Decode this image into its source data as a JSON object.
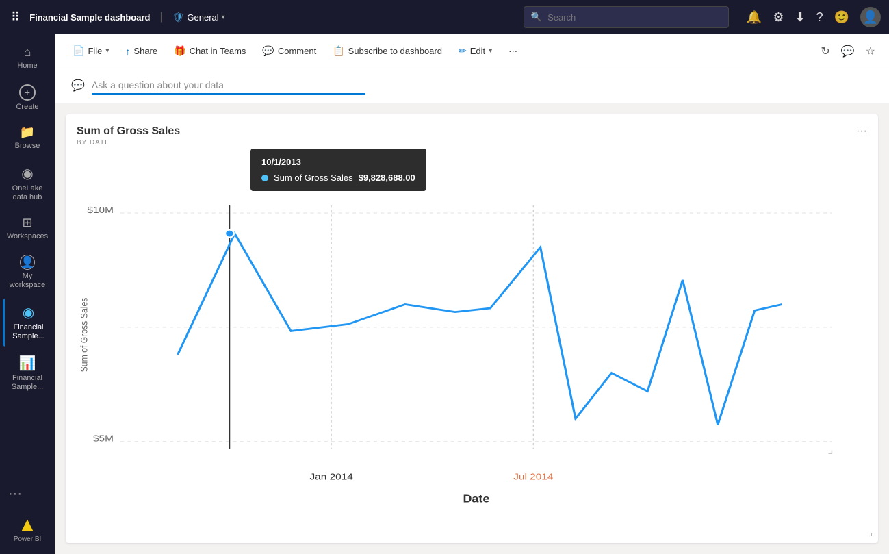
{
  "topnav": {
    "app_title": "Financial Sample dashboard",
    "workspace_name": "General",
    "search_placeholder": "Search"
  },
  "sidebar": {
    "items": [
      {
        "id": "home",
        "label": "Home",
        "icon": "⌂"
      },
      {
        "id": "create",
        "label": "Create",
        "icon": "+"
      },
      {
        "id": "browse",
        "label": "Browse",
        "icon": "📁"
      },
      {
        "id": "onelake",
        "label": "OneLake data hub",
        "icon": "◉"
      },
      {
        "id": "workspaces",
        "label": "Workspaces",
        "icon": "⊞"
      },
      {
        "id": "myworkspace",
        "label": "My workspace",
        "icon": "👤"
      },
      {
        "id": "financial_sample_active",
        "label": "Financial Sample...",
        "icon": "◉",
        "active": true
      },
      {
        "id": "financial_sample_report",
        "label": "Financial Sample...",
        "icon": "📊"
      }
    ],
    "more_label": "···",
    "powerbi_label": "Power BI"
  },
  "actionbar": {
    "file_label": "File",
    "share_label": "Share",
    "chat_label": "Chat in Teams",
    "comment_label": "Comment",
    "subscribe_label": "Subscribe to dashboard",
    "edit_label": "Edit",
    "more_label": "···",
    "refresh_tooltip": "Refresh",
    "chat_icon_tooltip": "Chat",
    "star_tooltip": "Favorite"
  },
  "qa": {
    "placeholder": "Ask a question about your data",
    "icon": "💬"
  },
  "chart": {
    "title": "Sum of Gross Sales",
    "subtitle": "BY DATE",
    "menu_icon": "···",
    "x_axis_label": "Date",
    "y_axis_label": "Sum of Gross Sales",
    "y_min": "$5M",
    "y_max": "$10M",
    "x_labels": [
      "Jan 2014",
      "Jul 2014"
    ],
    "x_label_colors": [
      "#333",
      "#e07040"
    ],
    "tooltip": {
      "date": "10/1/2013",
      "series_label": "Sum of Gross Sales",
      "series_value": "$9,828,688.00",
      "dot_color": "#4fc3f7"
    },
    "line_color": "#2196f3",
    "data_points": [
      {
        "x": 0.08,
        "y": 0.38
      },
      {
        "x": 0.16,
        "y": 0.9
      },
      {
        "x": 0.24,
        "y": 0.55
      },
      {
        "x": 0.32,
        "y": 0.52
      },
      {
        "x": 0.4,
        "y": 0.6
      },
      {
        "x": 0.47,
        "y": 0.56
      },
      {
        "x": 0.52,
        "y": 0.58
      },
      {
        "x": 0.59,
        "y": 0.85
      },
      {
        "x": 0.64,
        "y": 0.15
      },
      {
        "x": 0.69,
        "y": 0.3
      },
      {
        "x": 0.74,
        "y": 0.22
      },
      {
        "x": 0.79,
        "y": 0.68
      },
      {
        "x": 0.84,
        "y": 0.1
      },
      {
        "x": 0.89,
        "y": 0.56
      },
      {
        "x": 0.93,
        "y": 0.6
      }
    ]
  }
}
